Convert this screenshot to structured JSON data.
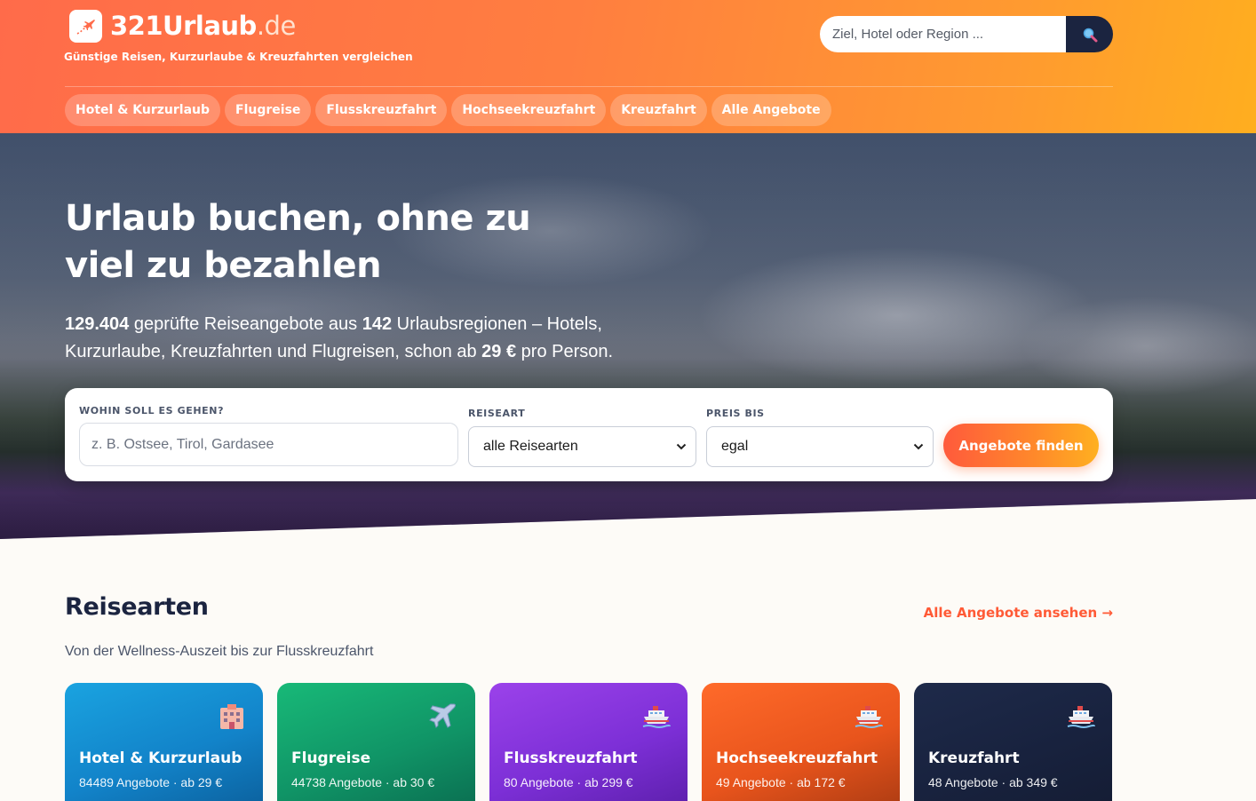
{
  "brand": {
    "name": "321Urlaub",
    "tld": ".de",
    "tagline": "Günstige Reisen, Kurzurlaube & Kreuzfahrten vergleichen",
    "accent": "#ff6b4a",
    "dark": "#1b2440"
  },
  "header_search": {
    "placeholder": "Ziel, Hotel oder Region ...",
    "icon": "search-icon"
  },
  "nav": {
    "items": [
      {
        "label": "Hotel & Kurzurlaub"
      },
      {
        "label": "Flugreise"
      },
      {
        "label": "Flusskreuzfahrt"
      },
      {
        "label": "Hochseekreuzfahrt"
      },
      {
        "label": "Kreuzfahrt"
      },
      {
        "label": "Alle Angebote"
      }
    ]
  },
  "hero": {
    "title_line1": "Urlaub buchen, ohne zu",
    "title_line2": "viel zu bezahlen",
    "offers_count": "129.404",
    "sub_part1": " geprüfte Reiseangebote aus ",
    "regions_count": "142",
    "sub_part2": " Urlaubsregionen – Hotels, Kurzurlaube, Kreuzfahrten und Flugreisen, schon ab ",
    "min_price": "29 €",
    "sub_part3": " pro Person."
  },
  "search_form": {
    "destination_label": "WOHIN SOLL ES GEHEN?",
    "destination_placeholder": "z. B. Ostsee, Tirol, Gardasee",
    "type_label": "REISEART",
    "type_value": "alle Reisearten",
    "price_label": "PREIS BIS",
    "price_value": "egal",
    "submit_label": "Angebote finden"
  },
  "section": {
    "title": "Reisearten",
    "subtitle": "Von der Wellness-Auszeit bis zur Flusskreuzfahrt",
    "link": "Alle Angebote ansehen →"
  },
  "cards": [
    {
      "title": "Hotel & Kurzurlaub",
      "meta": "84489 Angebote · ab 29 €",
      "icon": "hotel-icon"
    },
    {
      "title": "Flugreise",
      "meta": "44738 Angebote · ab 30 €",
      "icon": "airplane-icon"
    },
    {
      "title": "Flusskreuzfahrt",
      "meta": "80 Angebote · ab 299 €",
      "icon": "ship-icon"
    },
    {
      "title": "Hochseekreuzfahrt",
      "meta": "49 Angebote · ab 172 €",
      "icon": "ship-icon"
    },
    {
      "title": "Kreuzfahrt",
      "meta": "48 Angebote · ab 349 €",
      "icon": "ship-icon"
    }
  ]
}
